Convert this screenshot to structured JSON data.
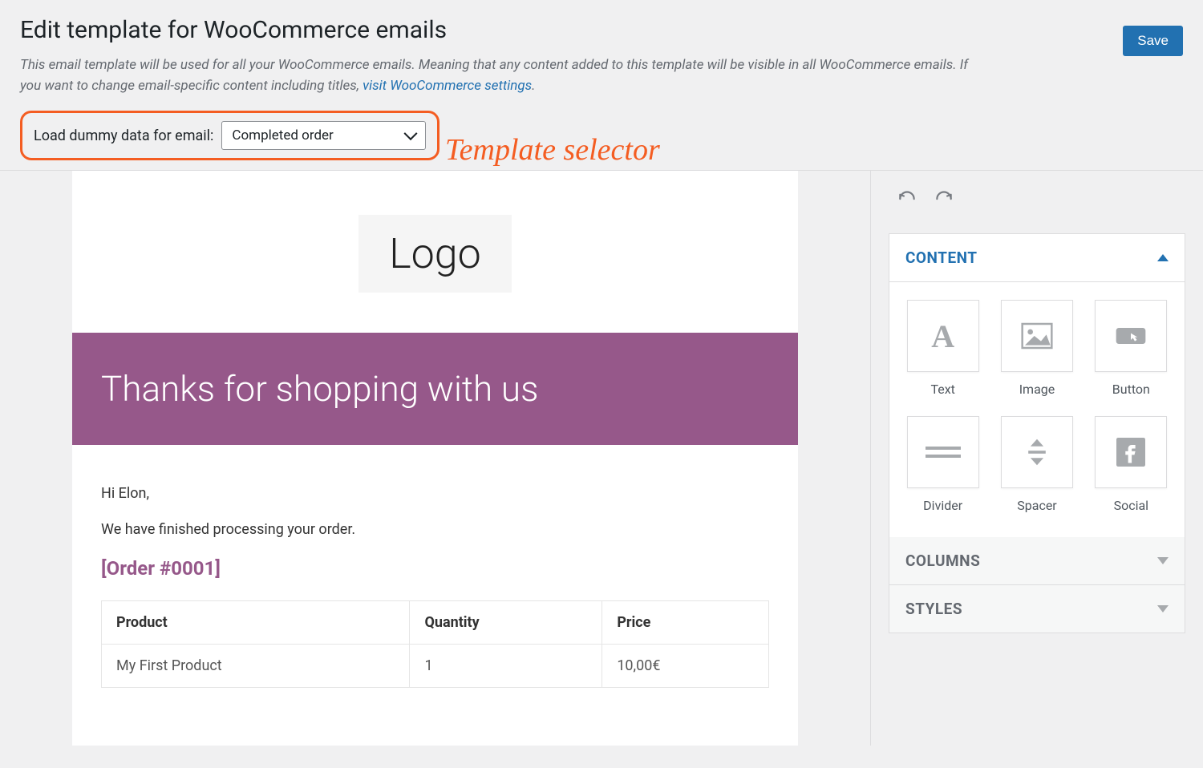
{
  "header": {
    "title": "Edit template for WooCommerce emails",
    "save_label": "Save",
    "description_part1": "This email template will be used for all your WooCommerce emails. Meaning that any content added to this template will be visible in all WooCommerce emails. If you want to change email-specific content including titles, ",
    "description_link": "visit WooCommerce settings",
    "description_end": "."
  },
  "selector": {
    "label": "Load dummy data for email:",
    "value": "Completed order",
    "annotation": "Template selector"
  },
  "email": {
    "logo_text": "Logo",
    "banner_title": "Thanks for shopping with us",
    "greeting": "Hi Elon,",
    "followup": "We have finished processing your order.",
    "order_heading": "[Order #0001]",
    "table": {
      "headers": [
        "Product",
        "Quantity",
        "Price"
      ],
      "rows": [
        {
          "product": "My First Product",
          "quantity": "1",
          "price": "10,00€"
        }
      ]
    }
  },
  "sidebar": {
    "panels": {
      "content": "CONTENT",
      "columns": "COLUMNS",
      "styles": "STYLES"
    },
    "blocks": [
      {
        "name": "text",
        "label": "Text"
      },
      {
        "name": "image",
        "label": "Image"
      },
      {
        "name": "button",
        "label": "Button"
      },
      {
        "name": "divider",
        "label": "Divider"
      },
      {
        "name": "spacer",
        "label": "Spacer"
      },
      {
        "name": "social",
        "label": "Social"
      }
    ]
  }
}
